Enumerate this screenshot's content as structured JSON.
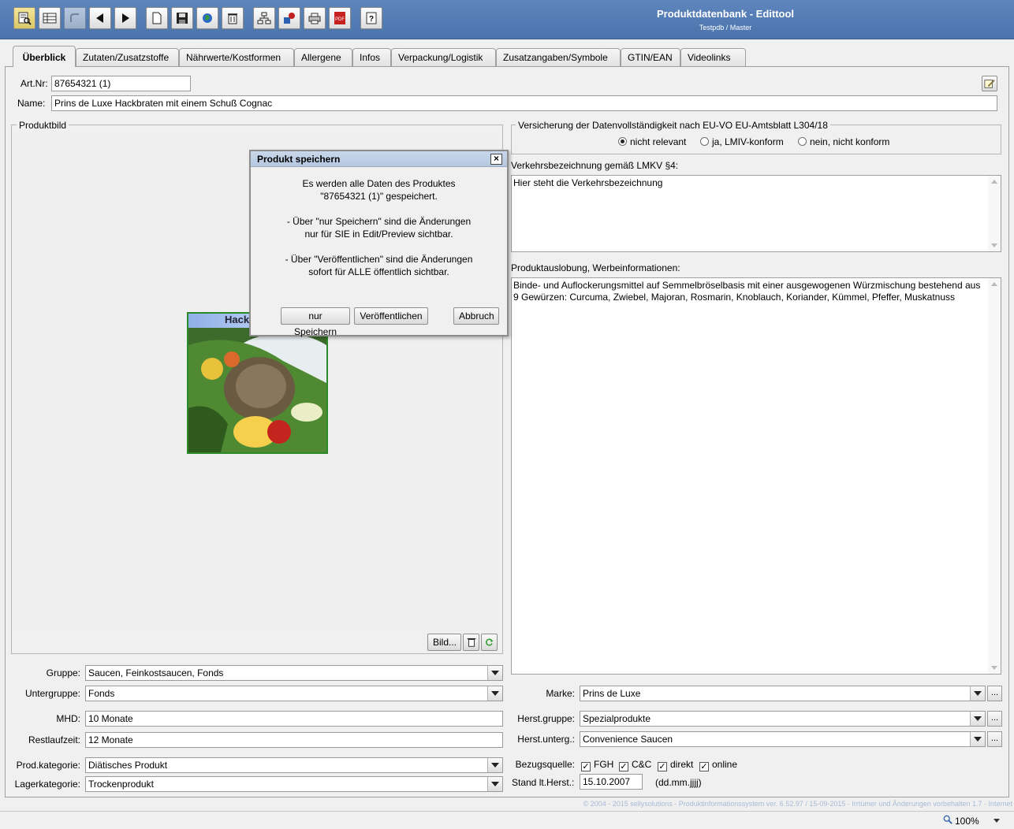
{
  "app": {
    "title": "Produktdatenbank - Edittool",
    "subtitle": "Testpdb / Master"
  },
  "toolbar": {
    "buttons": [
      {
        "name": "search-icon"
      },
      {
        "name": "table-icon"
      },
      {
        "name": "undo-icon"
      },
      {
        "name": "arrow-left-icon"
      },
      {
        "name": "arrow-right-icon"
      },
      {
        "name": "new-document-icon"
      },
      {
        "name": "save-icon"
      },
      {
        "name": "globe-icon"
      },
      {
        "name": "trash-icon"
      },
      {
        "name": "hierarchy-icon"
      },
      {
        "name": "tools-icon"
      },
      {
        "name": "print-icon"
      },
      {
        "name": "pdf-icon",
        "label": "PDF"
      },
      {
        "name": "help-icon",
        "label": "?"
      }
    ]
  },
  "tabs": [
    {
      "label": "Überblick",
      "active": true
    },
    {
      "label": "Zutaten/Zusatzstoffe"
    },
    {
      "label": "Nährwerte/Kostformen"
    },
    {
      "label": "Allergene"
    },
    {
      "label": "Infos"
    },
    {
      "label": "Verpackung/Logistik"
    },
    {
      "label": "Zusatzangaben/Symbole"
    },
    {
      "label": "GTIN/EAN"
    },
    {
      "label": "Videolinks"
    }
  ],
  "header": {
    "artnr_label": "Art.Nr:",
    "artnr_value": "87654321 (1)",
    "name_label": "Name:",
    "name_value": "Prins de Luxe Hackbraten mit einem Schuß Cognac"
  },
  "image_panel": {
    "title": "Produktbild",
    "image_text": "Hack",
    "bild_button": "Bild..."
  },
  "versicherung": {
    "title": "Versicherung der Datenvollständigkeit nach EU-VO EU-Amtsblatt L304/18",
    "options": [
      {
        "label": "nicht relevant",
        "selected": true
      },
      {
        "label": "ja, LMIV-konform",
        "selected": false
      },
      {
        "label": "nein, nicht konform",
        "selected": false
      }
    ]
  },
  "verkehrsbezeichnung": {
    "label": "Verkehrsbezeichnung gemäß LMKV §4:",
    "value": "Hier steht die Verkehrsbezeichnung"
  },
  "produktauslobung": {
    "label": "Produktauslobung, Werbeinformationen:",
    "value": "Binde- und Auflockerungsmittel auf Semmelbröselbasis mit einer ausgewogenen Würzmischung bestehend aus 9 Gewürzen: Curcuma, Zwiebel, Majoran, Rosmarin, Knoblauch, Koriander, Kümmel, Pfeffer, Muskatnuss"
  },
  "left_fields": {
    "gruppe_label": "Gruppe:",
    "gruppe_value": "Saucen, Feinkostsaucen, Fonds",
    "untergruppe_label": "Untergruppe:",
    "untergruppe_value": "Fonds",
    "mhd_label": "MHD:",
    "mhd_value": "10 Monate",
    "restlaufzeit_label": "Restlaufzeit:",
    "restlaufzeit_value": "12 Monate",
    "prodkategorie_label": "Prod.kategorie:",
    "prodkategorie_value": "Diätisches Produkt",
    "lagerkategorie_label": "Lagerkategorie:",
    "lagerkategorie_value": "Trockenprodukt"
  },
  "right_fields": {
    "marke_label": "Marke:",
    "marke_value": "Prins de Luxe",
    "herstgruppe_label": "Herst.gruppe:",
    "herstgruppe_value": "Spezialprodukte",
    "herstunterg_label": "Herst.unterg.:",
    "herstunterg_value": "Convenience Saucen",
    "dots_label": "...",
    "bezugsquelle_label": "Bezugsquelle:",
    "bezugsquellen": [
      {
        "label": "FGH",
        "checked": true
      },
      {
        "label": "C&C",
        "checked": true
      },
      {
        "label": "direkt",
        "checked": true
      },
      {
        "label": "online",
        "checked": true
      }
    ],
    "stand_label": "Stand lt.Herst.:",
    "stand_value": "15.10.2007",
    "stand_format": "(dd.mm.jjjj)"
  },
  "dialog": {
    "title": "Produkt speichern",
    "close": "×",
    "lines": [
      "Es werden alle Daten des Produktes",
      "\"87654321 (1)\" gespeichert.",
      "- Über \"nur Speichern\" sind die Änderungen",
      "nur für SIE in Edit/Preview sichtbar.",
      "- Über \"Veröffentlichen\" sind die Änderungen",
      "sofort für ALLE öffentlich sichtbar."
    ],
    "btn_save": "nur Speichern",
    "btn_publish": "Veröffentlichen",
    "btn_cancel": "Abbruch"
  },
  "footer": {
    "copyright": "© 2004 - 2015 sellysolutions - Produktinformationssystem ver. 6.52.97 / 15-09-2015 - Irrtümer und Änderungen vorbehalten  1.7 - Internet",
    "zoom": "100%"
  },
  "colors": {
    "titlebar": "#4a73ac",
    "image_border": "#2a8a2a"
  }
}
